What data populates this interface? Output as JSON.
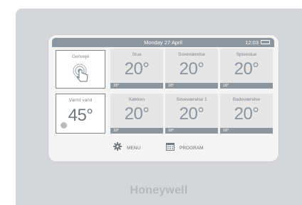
{
  "status": {
    "date": "Monday 27 April",
    "time": "12:03"
  },
  "shortcut": {
    "label": "Genveje",
    "icon": "touch-hand-icon"
  },
  "hot_water": {
    "label": "Varmt vand",
    "temp": "45°"
  },
  "zones": [
    {
      "name": "Stue",
      "temp": "20°",
      "setpoint": "18°"
    },
    {
      "name": "Soveværelse",
      "temp": "20°",
      "setpoint": "18°"
    },
    {
      "name": "Spisestue",
      "temp": "20°",
      "setpoint": "18°"
    },
    {
      "name": "Køkken",
      "temp": "20°",
      "setpoint": "18°"
    },
    {
      "name": "Soveværelse 1",
      "temp": "20°",
      "setpoint": "18°"
    },
    {
      "name": "Badeværelse",
      "temp": "20°",
      "setpoint": "18°"
    }
  ],
  "menu": {
    "menu_label": "MENU",
    "menu_icon": "gear-icon",
    "program_label": "PROGRAM",
    "program_icon": "calendar-icon"
  },
  "brand": "Honeywell",
  "colors": {
    "accent": "#8b969f",
    "tile_bg": "#e6e6e6",
    "device": "#d4d6d9"
  }
}
